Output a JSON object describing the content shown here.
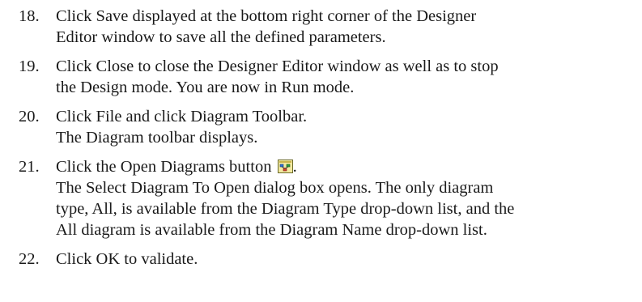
{
  "steps": [
    {
      "number": "18.",
      "lines": [
        "Click Save displayed at the bottom right corner of the Designer",
        "Editor window to save all the defined parameters."
      ]
    },
    {
      "number": "19.",
      "lines": [
        "Click Close to close the Designer Editor window as well as to stop",
        "the Design mode. You are now in Run mode."
      ]
    },
    {
      "number": "20.",
      "lines": [
        "Click File and click Diagram Toolbar.",
        "The Diagram toolbar displays."
      ]
    },
    {
      "number": "21.",
      "line1_text": "Click the Open Diagrams button",
      "line1_suffix": ".",
      "icon": "open-diagrams-icon",
      "lines": [
        "",
        "The Select Diagram To Open dialog box opens. The only diagram",
        "type, All, is available from the Diagram Type drop-down list, and the",
        "All diagram is available from the Diagram Name drop-down list."
      ]
    },
    {
      "number": "22.",
      "lines": [
        "Click OK to validate."
      ]
    }
  ]
}
